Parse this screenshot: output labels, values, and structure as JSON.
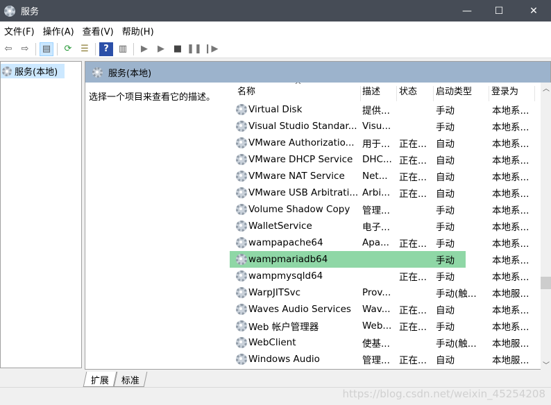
{
  "window": {
    "title": "服务",
    "minimize": "—",
    "maximize": "☐",
    "close": "✕"
  },
  "menu": [
    "文件(F)",
    "操作(A)",
    "查看(V)",
    "帮助(H)"
  ],
  "toolbar_icons": [
    "back-icon",
    "forward-icon",
    "show-console-tree-icon",
    "refresh-icon",
    "export-list-icon",
    "help-icon",
    "properties-icon",
    "start-icon",
    "start-alt-icon",
    "stop-icon",
    "pause-icon",
    "resume-icon"
  ],
  "tree": {
    "selected": "服务(本地)"
  },
  "panel": {
    "title": "服务(本地)",
    "description": "选择一个项目来查看它的描述。"
  },
  "columns": [
    "名称",
    "描述",
    "状态",
    "启动类型",
    "登录为"
  ],
  "sort_indicator": "^",
  "rows": [
    [
      "Virtual Disk",
      "提供...",
      "",
      "手动",
      "本地系..."
    ],
    [
      "Visual Studio Standar...",
      "Visu...",
      "",
      "手动",
      "本地系..."
    ],
    [
      "VMware Authorizatio...",
      "用于...",
      "正在...",
      "自动",
      "本地系..."
    ],
    [
      "VMware DHCP Service",
      "DHC...",
      "正在...",
      "自动",
      "本地系..."
    ],
    [
      "VMware NAT Service",
      "Net...",
      "正在...",
      "自动",
      "本地系..."
    ],
    [
      "VMware USB Arbitrati...",
      "Arbi...",
      "正在...",
      "自动",
      "本地系..."
    ],
    [
      "Volume Shadow Copy",
      "管理...",
      "",
      "手动",
      "本地系..."
    ],
    [
      "WalletService",
      "电子...",
      "",
      "手动",
      "本地系..."
    ],
    [
      "wampapache64",
      "Apa...",
      "正在...",
      "手动",
      "本地系..."
    ],
    [
      "wampmariadb64",
      "",
      "",
      "手动",
      "本地系..."
    ],
    [
      "wampmysqld64",
      "",
      "正在...",
      "手动",
      "本地系..."
    ],
    [
      "WarpJITSvc",
      "Prov...",
      "",
      "手动(触...",
      "本地服..."
    ],
    [
      "Waves Audio Services",
      "Wav...",
      "正在...",
      "自动",
      "本地系..."
    ],
    [
      "Web 帐户管理器",
      "Web...",
      "正在...",
      "手动",
      "本地系..."
    ],
    [
      "WebClient",
      "使基...",
      "",
      "手动(触...",
      "本地服..."
    ],
    [
      "Windows Audio",
      "管理...",
      "正在...",
      "自动",
      "本地服..."
    ]
  ],
  "selected_row": "wampmariadb64",
  "selection_color": "#8fd7a6",
  "tabs": [
    "扩展",
    "标准"
  ],
  "active_tab": "扩展",
  "watermark": "https://blog.csdn.net/weixin_45254208"
}
